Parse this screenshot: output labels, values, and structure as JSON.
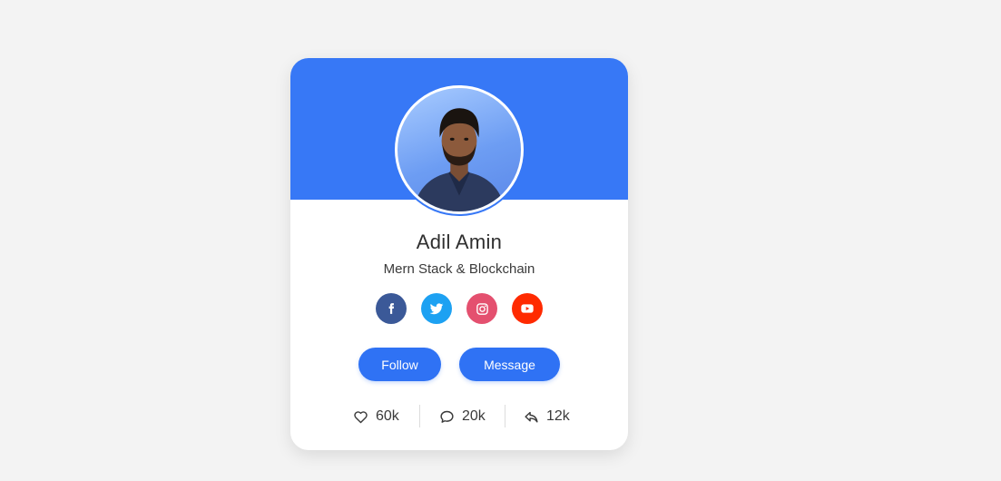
{
  "profile": {
    "name": "Adil Amin",
    "role": "Mern Stack & Blockchain"
  },
  "socials": [
    {
      "network": "facebook",
      "icon": "facebook-icon",
      "color": "#3b5998"
    },
    {
      "network": "twitter",
      "icon": "twitter-icon",
      "color": "#1da1f2"
    },
    {
      "network": "instagram",
      "icon": "instagram-icon",
      "color": "#e4506f"
    },
    {
      "network": "youtube",
      "icon": "youtube-icon",
      "color": "#ff2a00"
    }
  ],
  "actions": {
    "follow_label": "Follow",
    "message_label": "Message"
  },
  "stats": {
    "likes": "60k",
    "comments": "20k",
    "shares": "12k"
  },
  "colors": {
    "accent": "#3778f6",
    "button": "#2f72f4",
    "background": "#f3f3f3",
    "card": "#ffffff"
  }
}
